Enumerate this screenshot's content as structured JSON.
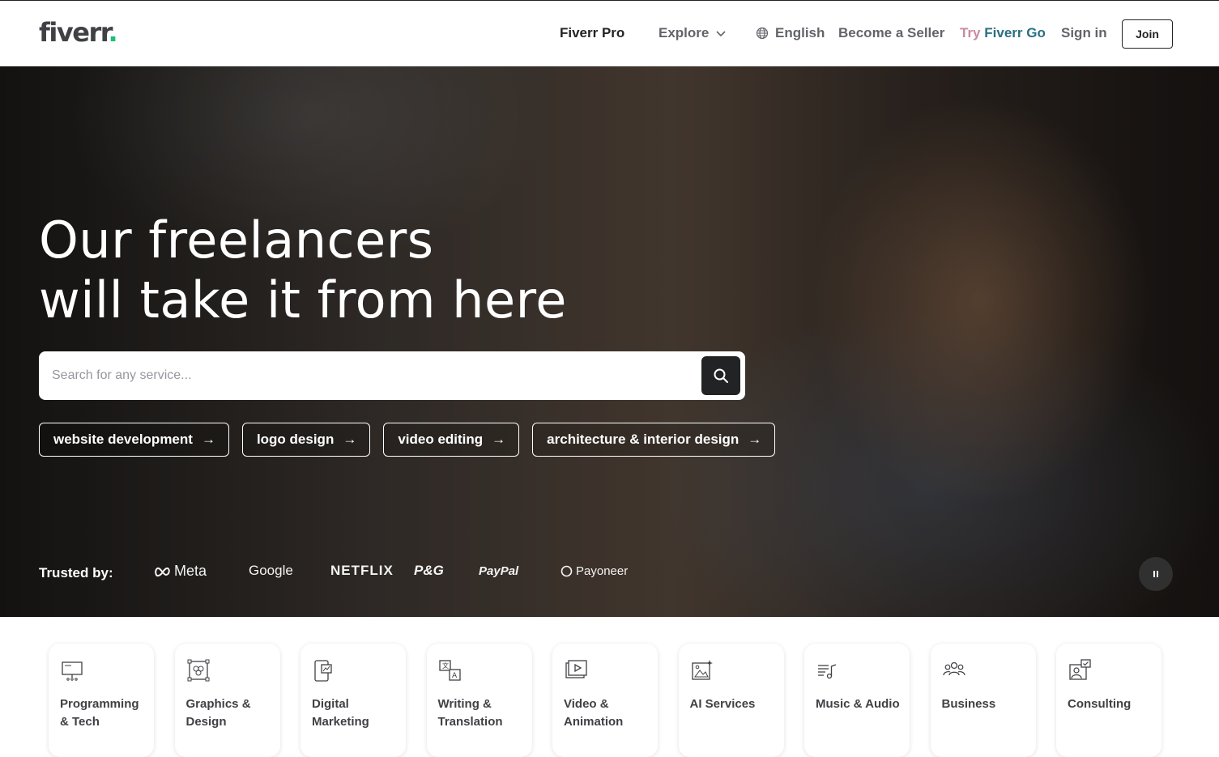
{
  "header": {
    "logo_text": "fiverr",
    "logo_dot": ".",
    "nav": {
      "pro": "Fiverr Pro",
      "explore": "Explore",
      "language": "English",
      "become_seller": "Become a Seller",
      "try_go_prefix": "Try",
      "try_go_brand": "Fiverr Go",
      "sign_in": "Sign in",
      "join": "Join"
    }
  },
  "hero": {
    "title_line1": "Our freelancers",
    "title_line2": "will take it from here",
    "search": {
      "placeholder": "Search for any service...",
      "value": ""
    },
    "pills": [
      {
        "label": "website development"
      },
      {
        "label": "logo design"
      },
      {
        "label": "video editing"
      },
      {
        "label": "architecture & interior design"
      }
    ],
    "trusted_label": "Trusted by:",
    "brands": {
      "meta": "Meta",
      "google": "Google",
      "netflix": "NETFLIX",
      "pg": "P&G",
      "paypal": "PayPal",
      "payoneer": "Payoneer"
    }
  },
  "categories": [
    {
      "label": "Programming & Tech",
      "icon": "monitor-code-icon"
    },
    {
      "label": "Graphics & Design",
      "icon": "design-frame-icon"
    },
    {
      "label": "Digital Marketing",
      "icon": "phone-chart-icon"
    },
    {
      "label": "Writing & Translation",
      "icon": "translate-icon"
    },
    {
      "label": "Video & Animation",
      "icon": "video-play-icon"
    },
    {
      "label": "AI Services",
      "icon": "ai-image-icon"
    },
    {
      "label": "Music & Audio",
      "icon": "music-note-icon"
    },
    {
      "label": "Business",
      "icon": "people-group-icon"
    },
    {
      "label": "Consulting",
      "icon": "consulting-icon"
    }
  ],
  "colors": {
    "brand_green": "#1dbf73",
    "text_dark": "#222325",
    "text_gray": "#62646a"
  }
}
